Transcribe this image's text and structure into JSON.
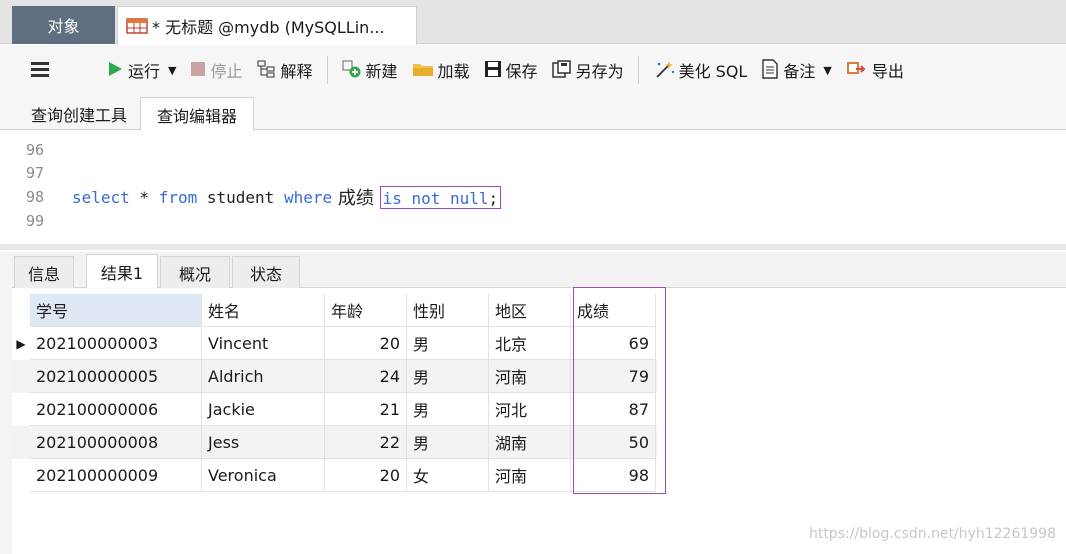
{
  "tabs": {
    "objects": "对象",
    "query": "* 无标题 @mydb (MySQLLin..."
  },
  "toolbar": {
    "menu_icon": "hamburger-icon",
    "run": "运行",
    "stop": "停止",
    "explain": "解释",
    "new": "新建",
    "load": "加载",
    "save": "保存",
    "save_as": "另存为",
    "beautify": "美化 SQL",
    "comment": "备注",
    "export": "导出"
  },
  "subtabs": [
    "查询创建工具",
    "查询编辑器"
  ],
  "editor": {
    "lines": [
      {
        "num": "96",
        "text": ""
      },
      {
        "num": "97",
        "text": ""
      },
      {
        "num": "98",
        "kw1": "select",
        "mid1": " * ",
        "kw2": "from",
        "mid2": " student ",
        "kw3": "where",
        "mid3": " 成绩 ",
        "hl": "is not null",
        "end": ";"
      },
      {
        "num": "99",
        "text": ""
      }
    ]
  },
  "result_tabs": [
    "信息",
    "结果1",
    "概况",
    "状态"
  ],
  "table": {
    "columns": [
      "学号",
      "姓名",
      "年龄",
      "性别",
      "地区",
      "成绩"
    ],
    "rows": [
      [
        "202100000003",
        "Vincent",
        "20",
        "男",
        "北京",
        "69"
      ],
      [
        "202100000005",
        "Aldrich",
        "24",
        "男",
        "河南",
        "79"
      ],
      [
        "202100000006",
        "Jackie",
        "21",
        "男",
        "河北",
        "87"
      ],
      [
        "202100000008",
        "Jess",
        "22",
        "男",
        "湖南",
        "50"
      ],
      [
        "202100000009",
        "Veronica",
        "20",
        "女",
        "河南",
        "98"
      ]
    ]
  },
  "watermark": "https://blog.csdn.net/hyh12261998",
  "colors": {
    "keyword": "#3a6ad8",
    "highlight_box": "#a04ab5",
    "run_icon": "#2fa84f",
    "header_selected": "#dfe9f6"
  }
}
